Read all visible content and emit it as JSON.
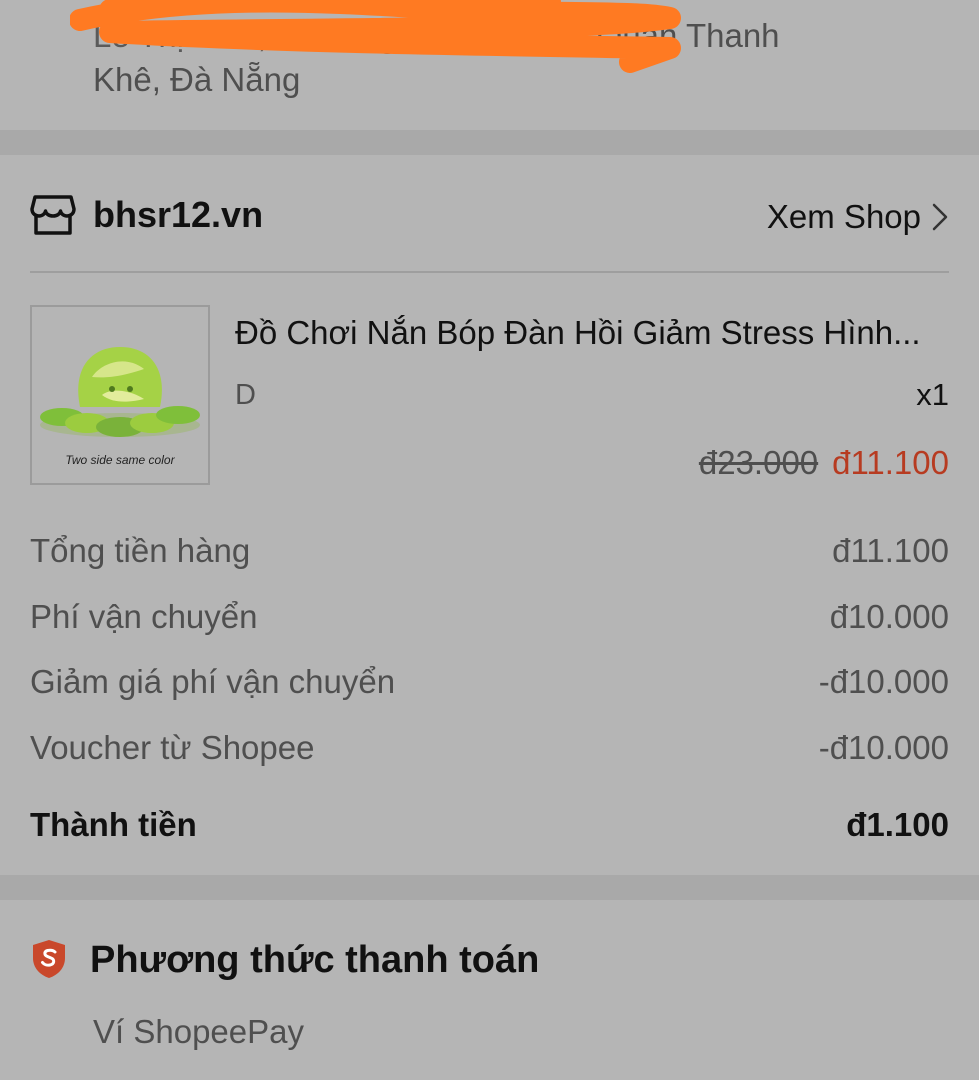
{
  "address": {
    "line1_visible": ", Quận Thanh",
    "line2": "Khê, Đà Nẵng"
  },
  "shop": {
    "name": "bhsr12.vn",
    "view_shop_label": "Xem Shop"
  },
  "product": {
    "name": "Đồ Chơi Nắn Bóp Đàn Hồi Giảm Stress Hình...",
    "image_caption": "Two side same color",
    "variant": "D",
    "quantity": "x1",
    "original_price": "đ23.000",
    "sale_price": "đ11.100"
  },
  "summary": {
    "rows": [
      {
        "label": "Tổng tiền hàng",
        "value": "đ11.100"
      },
      {
        "label": "Phí vận chuyển",
        "value": "đ10.000"
      },
      {
        "label": "Giảm giá phí vận chuyển",
        "value": "-đ10.000"
      },
      {
        "label": "Voucher từ Shopee",
        "value": "-đ10.000"
      }
    ],
    "total_label": "Thành tiền",
    "total_value": "đ1.100"
  },
  "payment": {
    "title": "Phương thức thanh toán",
    "method": "Ví ShopeePay"
  },
  "colors": {
    "background": "#b5b5b5",
    "sale_red": "#b73b21",
    "scribble_orange": "#ff7a22"
  },
  "icons": {
    "shop": "storefront-icon",
    "chevron": "chevron-right-icon",
    "payment": "shopee-shield-icon"
  }
}
